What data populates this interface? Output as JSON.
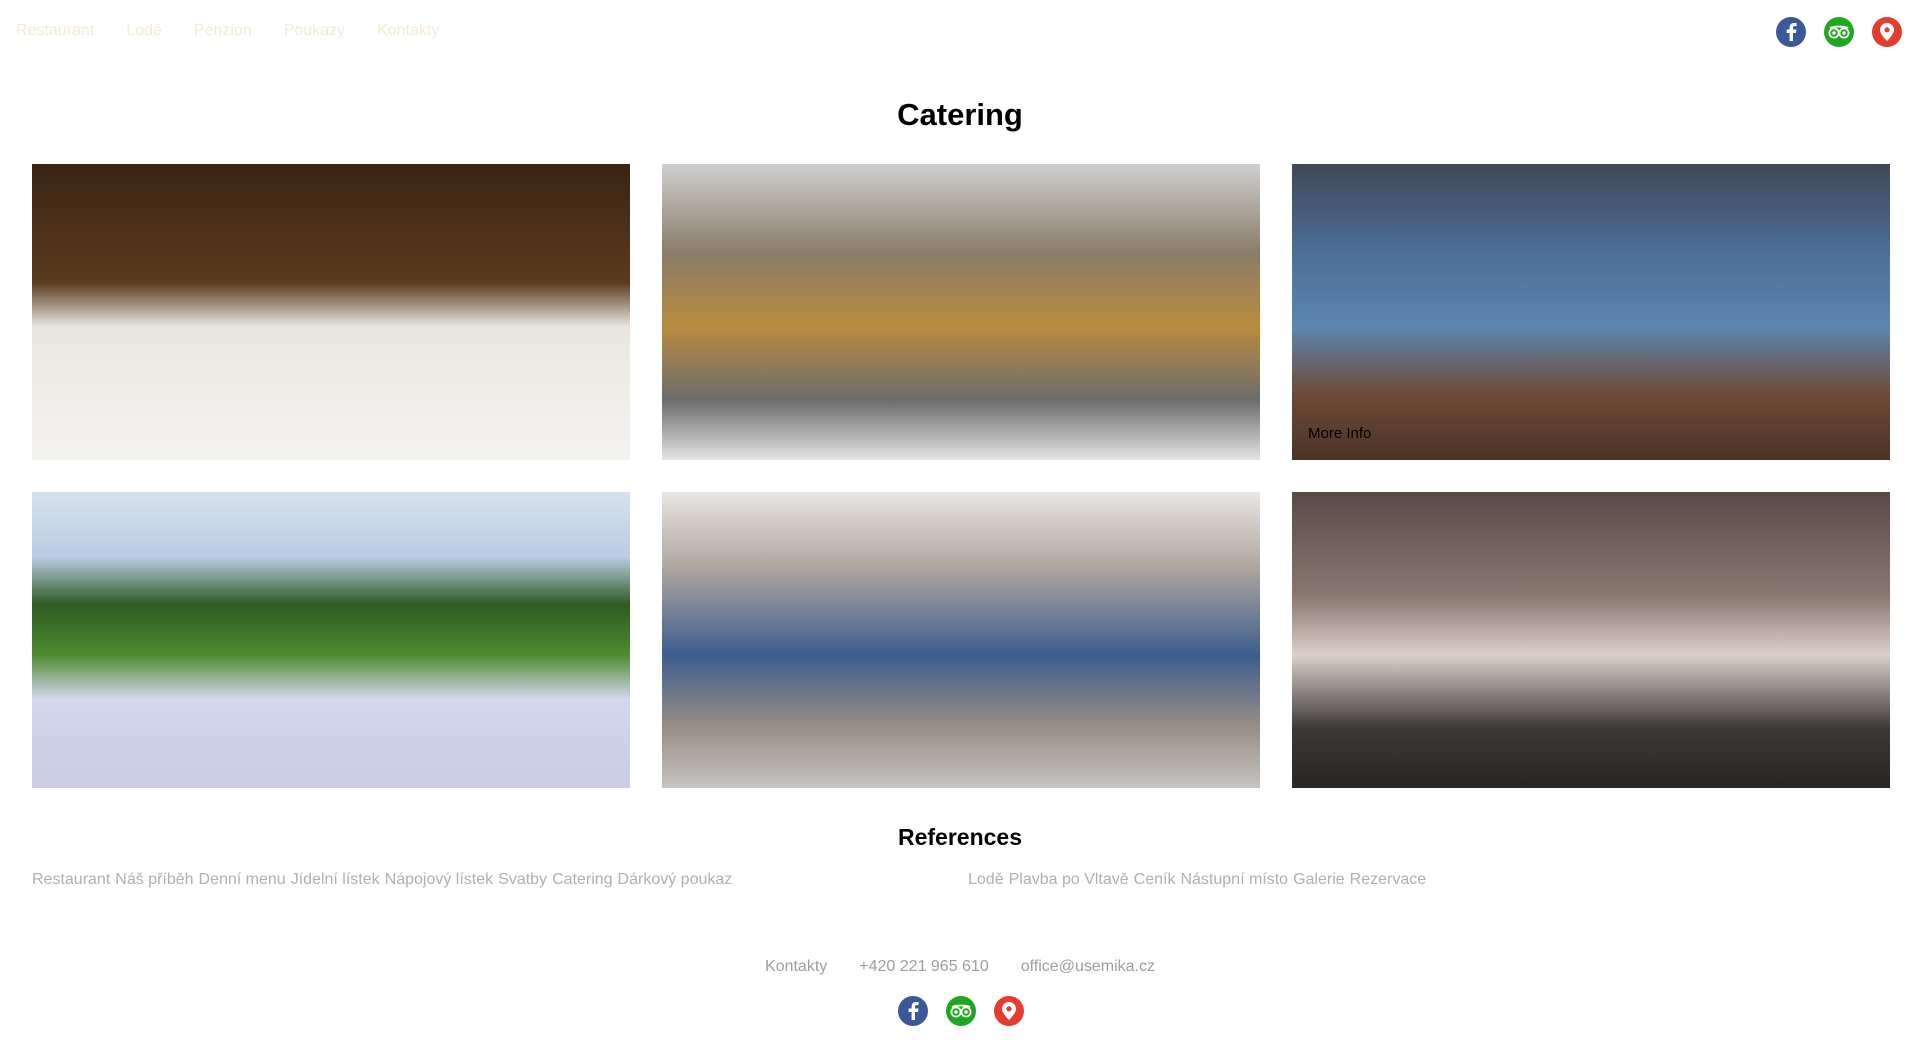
{
  "nav": {
    "links": [
      "Restaurant",
      "Lodě",
      "Penzion",
      "Poukazy",
      "Kontakty"
    ]
  },
  "social": {
    "icons": [
      "facebook-icon",
      "tripadvisor-icon",
      "map-pin-icon"
    ],
    "colors": {
      "facebook": "#3b5998",
      "tripadvisor": "#1fa81f",
      "maps": "#e43d30"
    }
  },
  "catering": {
    "title": "Catering",
    "tiles": [
      {
        "subject": "banquet table in library"
      },
      {
        "subject": "buffet serving trays"
      },
      {
        "subject": "dining table on boat deck",
        "more_label": "More Info"
      },
      {
        "subject": "outdoor garden wedding"
      },
      {
        "subject": "crowd of people outdoors"
      },
      {
        "subject": "coffee and cake"
      }
    ]
  },
  "references": {
    "title": "References",
    "left": [
      "Restaurant",
      "Náš příběh",
      "Denní menu",
      "Jídelní lístek",
      "Nápojový lístek",
      "Svatby",
      "Catering",
      "Dárkový poukaz"
    ],
    "right": [
      "Lodě",
      "Plavba po Vltavě",
      "Ceník",
      "Nástupní místo",
      "Galerie",
      "Rezervace"
    ]
  },
  "footer": {
    "contacts_label": "Kontakty",
    "phone": "+420 221 965 610",
    "email": "office@usemika.cz"
  }
}
